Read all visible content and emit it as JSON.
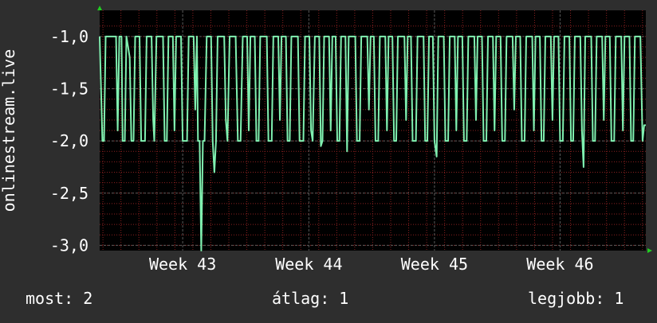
{
  "colors": {
    "background": "#2e2e2e",
    "plot_background": "#000000",
    "line": "#80f0b0",
    "grid": "#5a5a5a",
    "minor_grid": "#8a2020",
    "axis_arrow": "#22cc22",
    "text": "#ffffff"
  },
  "legend": {
    "now_label": "most:",
    "now_value": "2",
    "avg_label": "átlag:",
    "avg_value": "1",
    "best_label": "legjobb:",
    "best_value": "1"
  },
  "chart_data": {
    "type": "line",
    "ylabel": "onlinestream.live",
    "xlabel": "",
    "title": "",
    "ylim": [
      -3.05,
      -0.75
    ],
    "xlim": [
      0,
      100
    ],
    "y_ticks": [
      {
        "value": -1.0,
        "label": "-1,0"
      },
      {
        "value": -1.5,
        "label": "-1,5"
      },
      {
        "value": -2.0,
        "label": "-2,0"
      },
      {
        "value": -2.5,
        "label": "-2,5"
      },
      {
        "value": -3.0,
        "label": "-3,0"
      }
    ],
    "x_ticks": [
      {
        "value": 15.2,
        "label": "Week 43"
      },
      {
        "value": 38.3,
        "label": "Week 44"
      },
      {
        "value": 61.3,
        "label": "Week 45"
      },
      {
        "value": 84.3,
        "label": "Week 46"
      }
    ],
    "grid": true,
    "series": [
      {
        "name": "",
        "values": [
          [
            0.0,
            -1.0
          ],
          [
            0.5,
            -2.0
          ],
          [
            0.8,
            -2.0
          ],
          [
            1.1,
            -1.0
          ],
          [
            3.0,
            -1.0
          ],
          [
            3.3,
            -1.9
          ],
          [
            3.6,
            -1.0
          ],
          [
            4.0,
            -1.0
          ],
          [
            4.2,
            -2.0
          ],
          [
            4.6,
            -2.0
          ],
          [
            4.9,
            -1.0
          ],
          [
            5.5,
            -1.2
          ],
          [
            5.8,
            -2.0
          ],
          [
            6.2,
            -2.0
          ],
          [
            6.5,
            -1.0
          ],
          [
            7.3,
            -1.0
          ],
          [
            7.6,
            -2.0
          ],
          [
            8.3,
            -2.0
          ],
          [
            8.6,
            -1.0
          ],
          [
            9.5,
            -1.0
          ],
          [
            9.8,
            -1.8
          ],
          [
            10.0,
            -2.0
          ],
          [
            10.4,
            -1.0
          ],
          [
            11.6,
            -1.0
          ],
          [
            11.9,
            -2.0
          ],
          [
            12.3,
            -2.0
          ],
          [
            12.6,
            -1.0
          ],
          [
            13.4,
            -1.0
          ],
          [
            13.7,
            -1.9
          ],
          [
            14.0,
            -1.0
          ],
          [
            14.9,
            -1.0
          ],
          [
            15.2,
            -2.0
          ],
          [
            16.0,
            -2.0
          ],
          [
            16.3,
            -1.0
          ],
          [
            17.2,
            -1.0
          ],
          [
            17.5,
            -1.7
          ],
          [
            17.8,
            -1.0
          ],
          [
            18.0,
            -2.0
          ],
          [
            18.3,
            -2.0
          ],
          [
            18.6,
            -3.05
          ],
          [
            18.9,
            -2.0
          ],
          [
            19.2,
            -2.0
          ],
          [
            19.6,
            -1.0
          ],
          [
            20.4,
            -1.0
          ],
          [
            20.7,
            -2.0
          ],
          [
            21.0,
            -2.3
          ],
          [
            21.3,
            -2.0
          ],
          [
            21.6,
            -1.0
          ],
          [
            22.8,
            -1.0
          ],
          [
            23.1,
            -1.8
          ],
          [
            23.4,
            -2.0
          ],
          [
            23.8,
            -1.0
          ],
          [
            24.9,
            -1.0
          ],
          [
            25.3,
            -2.0
          ],
          [
            25.8,
            -2.0
          ],
          [
            26.2,
            -1.0
          ],
          [
            27.0,
            -1.0
          ],
          [
            27.3,
            -1.9
          ],
          [
            27.6,
            -1.0
          ],
          [
            28.4,
            -1.0
          ],
          [
            28.7,
            -2.0
          ],
          [
            29.1,
            -2.0
          ],
          [
            29.4,
            -1.0
          ],
          [
            30.6,
            -1.0
          ],
          [
            30.9,
            -2.0
          ],
          [
            31.5,
            -2.0
          ],
          [
            31.8,
            -1.0
          ],
          [
            32.7,
            -1.0
          ],
          [
            33.0,
            -1.8
          ],
          [
            33.3,
            -1.0
          ],
          [
            34.1,
            -1.0
          ],
          [
            34.4,
            -2.0
          ],
          [
            34.8,
            -2.0
          ],
          [
            35.1,
            -1.0
          ],
          [
            36.3,
            -1.0
          ],
          [
            36.6,
            -2.0
          ],
          [
            37.3,
            -2.0
          ],
          [
            37.6,
            -1.0
          ],
          [
            38.4,
            -1.0
          ],
          [
            38.7,
            -1.9
          ],
          [
            39.0,
            -2.0
          ],
          [
            39.4,
            -1.0
          ],
          [
            40.2,
            -1.0
          ],
          [
            40.5,
            -2.05
          ],
          [
            40.8,
            -2.0
          ],
          [
            41.1,
            -1.0
          ],
          [
            42.0,
            -1.0
          ],
          [
            42.3,
            -1.9
          ],
          [
            42.6,
            -1.0
          ],
          [
            43.2,
            -1.0
          ],
          [
            43.5,
            -2.0
          ],
          [
            43.9,
            -2.0
          ],
          [
            44.2,
            -1.0
          ],
          [
            45.0,
            -1.0
          ],
          [
            45.3,
            -2.1
          ],
          [
            45.6,
            -1.0
          ],
          [
            46.8,
            -1.0
          ],
          [
            47.1,
            -2.0
          ],
          [
            47.6,
            -2.0
          ],
          [
            47.9,
            -1.0
          ],
          [
            49.0,
            -1.0
          ],
          [
            49.3,
            -1.7
          ],
          [
            49.6,
            -1.0
          ],
          [
            50.2,
            -1.0
          ],
          [
            50.5,
            -2.0
          ],
          [
            51.0,
            -2.0
          ],
          [
            51.3,
            -1.0
          ],
          [
            52.3,
            -1.0
          ],
          [
            52.6,
            -1.9
          ],
          [
            52.9,
            -1.0
          ],
          [
            53.6,
            -1.0
          ],
          [
            53.9,
            -2.0
          ],
          [
            54.3,
            -2.0
          ],
          [
            54.6,
            -1.0
          ],
          [
            55.8,
            -1.0
          ],
          [
            56.1,
            -1.8
          ],
          [
            56.4,
            -1.0
          ],
          [
            57.0,
            -1.0
          ],
          [
            57.3,
            -2.0
          ],
          [
            57.9,
            -2.0
          ],
          [
            58.2,
            -1.0
          ],
          [
            59.3,
            -1.0
          ],
          [
            59.6,
            -2.0
          ],
          [
            60.0,
            -2.0
          ],
          [
            60.3,
            -1.0
          ],
          [
            61.0,
            -1.0
          ],
          [
            61.3,
            -2.0
          ],
          [
            61.7,
            -2.15
          ],
          [
            62.0,
            -1.0
          ],
          [
            63.0,
            -1.0
          ],
          [
            63.3,
            -2.0
          ],
          [
            63.8,
            -2.0
          ],
          [
            64.1,
            -1.0
          ],
          [
            65.0,
            -1.0
          ],
          [
            65.3,
            -1.9
          ],
          [
            65.6,
            -1.0
          ],
          [
            66.4,
            -1.0
          ],
          [
            66.7,
            -2.0
          ],
          [
            67.2,
            -2.0
          ],
          [
            67.5,
            -1.0
          ],
          [
            68.6,
            -1.0
          ],
          [
            68.9,
            -1.8
          ],
          [
            69.2,
            -1.0
          ],
          [
            70.0,
            -1.0
          ],
          [
            70.3,
            -2.0
          ],
          [
            70.8,
            -2.0
          ],
          [
            71.1,
            -1.0
          ],
          [
            72.0,
            -1.0
          ],
          [
            72.3,
            -1.9
          ],
          [
            72.6,
            -1.0
          ],
          [
            73.4,
            -1.0
          ],
          [
            73.7,
            -2.0
          ],
          [
            74.2,
            -2.0
          ],
          [
            74.5,
            -1.0
          ],
          [
            75.6,
            -1.0
          ],
          [
            75.9,
            -1.7
          ],
          [
            76.2,
            -1.0
          ],
          [
            77.0,
            -1.0
          ],
          [
            77.3,
            -2.0
          ],
          [
            77.8,
            -2.0
          ],
          [
            78.1,
            -1.0
          ],
          [
            79.2,
            -1.0
          ],
          [
            79.5,
            -1.9
          ],
          [
            79.8,
            -1.0
          ],
          [
            80.6,
            -1.0
          ],
          [
            80.9,
            -2.0
          ],
          [
            81.3,
            -2.0
          ],
          [
            81.6,
            -1.0
          ],
          [
            82.6,
            -1.0
          ],
          [
            82.9,
            -1.8
          ],
          [
            83.2,
            -1.0
          ],
          [
            84.0,
            -1.0
          ],
          [
            84.3,
            -2.0
          ],
          [
            84.8,
            -2.0
          ],
          [
            85.1,
            -1.0
          ],
          [
            86.0,
            -1.0
          ],
          [
            86.3,
            -2.0
          ],
          [
            86.7,
            -2.0
          ],
          [
            87.0,
            -1.0
          ],
          [
            88.0,
            -1.0
          ],
          [
            88.3,
            -1.9
          ],
          [
            88.6,
            -2.25
          ],
          [
            88.9,
            -1.0
          ],
          [
            90.0,
            -1.0
          ],
          [
            90.3,
            -2.0
          ],
          [
            90.7,
            -2.0
          ],
          [
            91.0,
            -1.0
          ],
          [
            92.0,
            -1.0
          ],
          [
            92.3,
            -1.8
          ],
          [
            92.6,
            -1.0
          ],
          [
            93.4,
            -1.0
          ],
          [
            93.7,
            -2.0
          ],
          [
            94.2,
            -2.0
          ],
          [
            94.5,
            -1.0
          ],
          [
            95.5,
            -1.0
          ],
          [
            95.8,
            -1.9
          ],
          [
            96.1,
            -1.0
          ],
          [
            97.0,
            -1.0
          ],
          [
            97.3,
            -2.0
          ],
          [
            97.7,
            -2.0
          ],
          [
            98.0,
            -1.0
          ],
          [
            99.0,
            -1.0
          ],
          [
            99.2,
            -1.5
          ],
          [
            99.4,
            -2.0
          ],
          [
            99.7,
            -1.85
          ],
          [
            100.0,
            -1.85
          ]
        ]
      }
    ]
  }
}
